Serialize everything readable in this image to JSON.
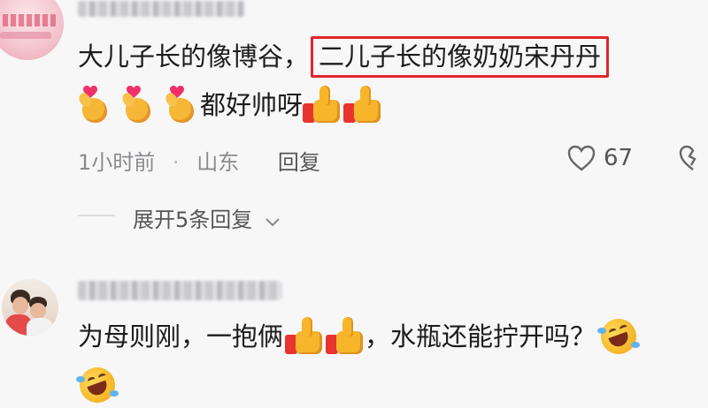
{
  "comments": [
    {
      "text_prefix": "大儿子长的像博谷，",
      "text_highlight": "二儿子长的像奶奶宋丹丹",
      "line2_text": "都好帅呀",
      "line2_leading_emoji": "finger-heart-icon x3",
      "line2_trailing_emoji": "thumbs-up-icon x2",
      "time": "1小时前",
      "separator": "·",
      "location": "山东",
      "reply_label": "回复",
      "like_count": "67",
      "expand_label": "展开5条回复",
      "highlight_color": "#e0262b"
    },
    {
      "text_prefix": "为母则刚，一抱俩",
      "text_suffix": "，水瓶还能拧开吗？",
      "inline_emoji": "thumbs-up-icon x2",
      "trailing_emoji": "rofl-icon"
    }
  ]
}
